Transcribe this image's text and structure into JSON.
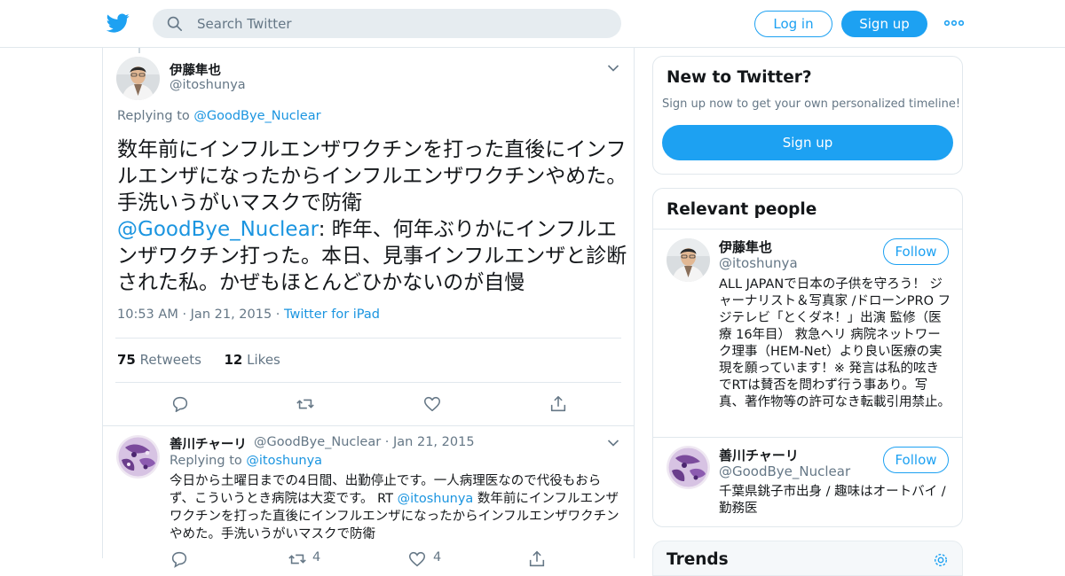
{
  "header": {
    "search_placeholder": "Search Twitter",
    "login_label": "Log in",
    "signup_label": "Sign up",
    "brand_color": "#1da1f2"
  },
  "tweet": {
    "author_name": "伊藤隼也",
    "author_handle": "@itoshunya",
    "replying_prefix": "Replying to ",
    "replying_handle": "@GoodBye_Nuclear",
    "text_part1": "数年前にインフルエンザワクチンを打った直後にインフルエンザになったからインフルエンザワクチンやめた。手洗いうがいマスクで防衛",
    "quoted_handle": "@GoodBye_Nuclear",
    "text_part2": ": 昨年、何年ぶりかにインフルエンザワクチン打った。本日、見事インフルエンザと診断された私。かぜもほとんどひかないのが自慢",
    "time": "10:53 AM",
    "date": "Jan 21, 2015",
    "client": "Twitter for iPad",
    "retweets_count": "75",
    "retweets_label": "Retweets",
    "likes_count": "12",
    "likes_label": "Likes"
  },
  "reply": {
    "author_name": "善川チャーリ",
    "author_handle": "@GoodBye_Nuclear",
    "date": "Jan 21, 2015",
    "replying_prefix": "Replying to ",
    "replying_handle": "@itoshunya",
    "text_part1": "今日から土曜日までの4日間、出勤停止です。一人病理医なので代役もおらず、こういうとき病院は大変です。 RT ",
    "mention": "@itoshunya",
    "text_part2": " 数年前にインフルエンザワクチンを打った直後にインフルエンザになったからインフルエンザワクチンやめた。手洗いうがいマスクで防衛",
    "retweet_count": "4",
    "like_count": "4"
  },
  "sidebar": {
    "new_title": "New to Twitter?",
    "new_sub": "Sign up now to get your own personalized timeline!",
    "new_signup": "Sign up",
    "relevant_title": "Relevant people",
    "people": [
      {
        "name": "伊藤隼也",
        "handle": "@itoshunya",
        "follow": "Follow",
        "bio": "ALL JAPANで日本の子供を守ろう！ ジャーナリスト＆写真家 /ドローンPRO フジテレビ「とくダネ！」出演 監修（医療 16年目） 救急ヘリ 病院ネットワーク理事（HEM-Net）より良い医療の実現を願っています！※ 発言は私的呟きでRTは賛否を問わず行う事あり。写真、著作物等の許可なき転載引用禁止。"
      },
      {
        "name": "善川チャーリ",
        "handle": "@GoodBye_Nuclear",
        "follow": "Follow",
        "bio": "千葉県銚子市出身 / 趣味はオートバイ / 勤務医"
      }
    ],
    "trends_title": "Trends"
  }
}
